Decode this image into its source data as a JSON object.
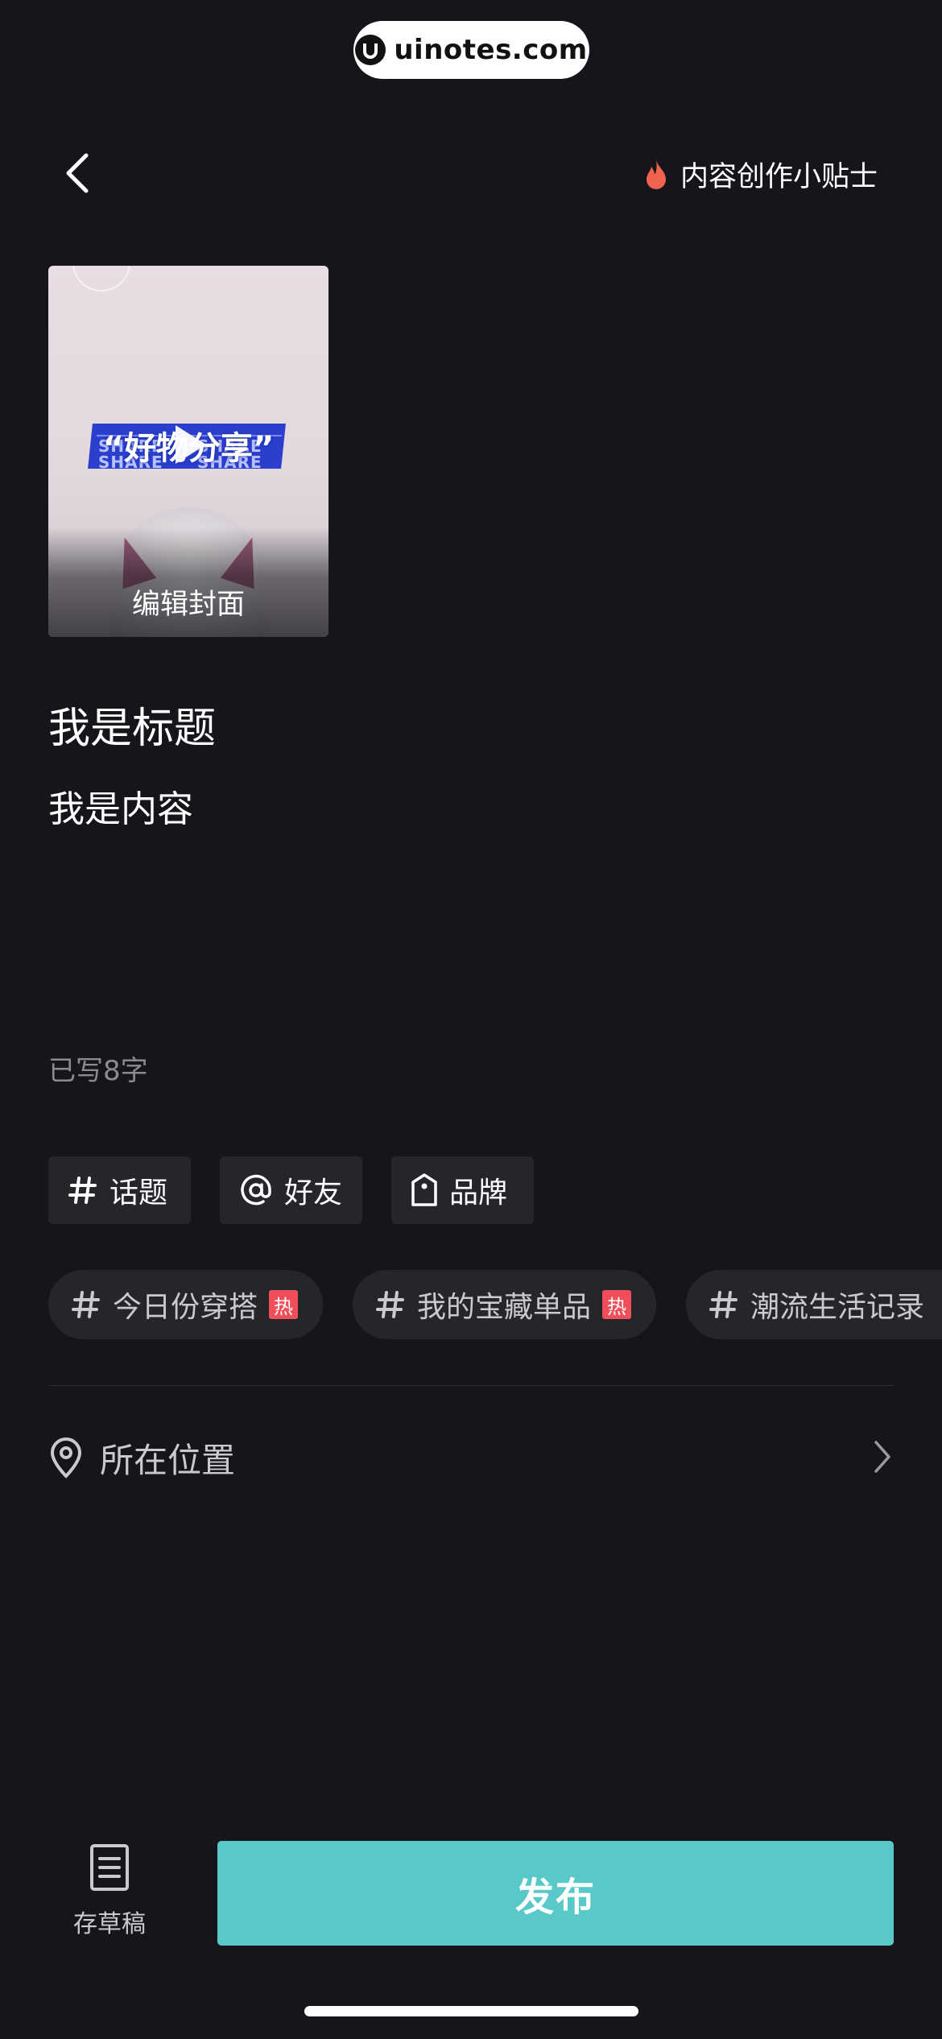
{
  "watermark": {
    "text": "uinotes.com"
  },
  "header": {
    "tips_label": "内容创作小贴士"
  },
  "cover": {
    "overlay_title": "“好物分享”",
    "band_text": "SHARE",
    "edit_label": "编辑封面"
  },
  "post": {
    "title": "我是标题",
    "body": "我是内容",
    "char_count": "已写8字"
  },
  "chips": [
    {
      "label": "话题",
      "icon": "hash-icon"
    },
    {
      "label": "好友",
      "icon": "at-icon"
    },
    {
      "label": "品牌",
      "icon": "tag-icon"
    }
  ],
  "topics": [
    {
      "label": "今日份穿搭",
      "badge": "热"
    },
    {
      "label": "我的宝藏单品",
      "badge": "热"
    },
    {
      "label": "潮流生活记录",
      "badge": ""
    }
  ],
  "location": {
    "label": "所在位置"
  },
  "bottom": {
    "draft_label": "存草稿",
    "publish_label": "发布"
  },
  "colors": {
    "background": "#15151b",
    "chip_bg": "#25252c",
    "publish": "#58c8c8",
    "hot_badge": "#f04f5a",
    "tips_flame": "#f0644f"
  }
}
